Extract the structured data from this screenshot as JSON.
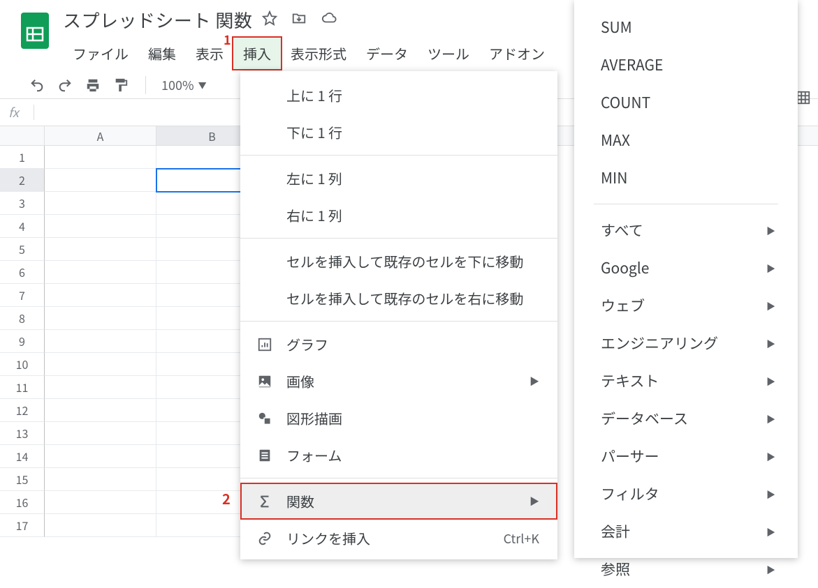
{
  "doc": {
    "title": "スプレッドシート 関数"
  },
  "menubar": {
    "file": "ファイル",
    "edit": "編集",
    "view": "表示",
    "insert": "挿入",
    "format": "表示形式",
    "data": "データ",
    "tools": "ツール",
    "addons": "アドオン"
  },
  "toolbar": {
    "zoom": "100%"
  },
  "annotations": {
    "one": "1",
    "two": "2"
  },
  "columns": [
    "A",
    "B"
  ],
  "rows": [
    "1",
    "2",
    "3",
    "4",
    "5",
    "6",
    "7",
    "8",
    "9",
    "10",
    "11",
    "12",
    "13",
    "14",
    "15",
    "16",
    "17"
  ],
  "selected_cell": {
    "row": 2,
    "col": "B"
  },
  "insert_menu": {
    "row_above": "上に 1 行",
    "row_below": "下に 1 行",
    "col_left": "左に 1 列",
    "col_right": "右に 1 列",
    "shift_down": "セルを挿入して既存のセルを下に移動",
    "shift_right": "セルを挿入して既存のセルを右に移動",
    "chart": "グラフ",
    "image": "画像",
    "drawing": "図形描画",
    "form": "フォーム",
    "function": "関数",
    "link": "リンクを挿入",
    "link_shortcut": "Ctrl+K"
  },
  "function_menu": {
    "basic": [
      "SUM",
      "AVERAGE",
      "COUNT",
      "MAX",
      "MIN"
    ],
    "categories": [
      "すべて",
      "Google",
      "ウェブ",
      "エンジニアリング",
      "テキスト",
      "データベース",
      "パーサー",
      "フィルタ",
      "会計",
      "参照"
    ]
  }
}
